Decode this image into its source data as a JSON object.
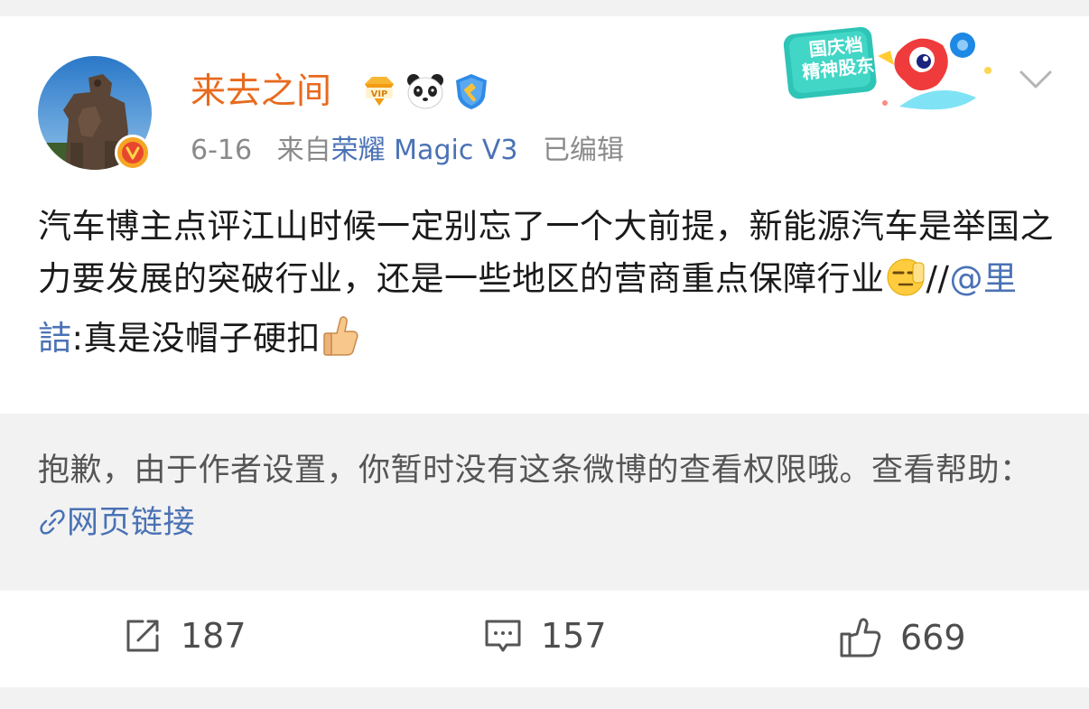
{
  "user": {
    "name": "来去之间",
    "verified_badge_icon": "orange-verified-v-icon",
    "badges": [
      "gold-vip-diamond-icon",
      "panda-icon",
      "blue-gavel-shield-icon"
    ]
  },
  "meta": {
    "date": "6-16",
    "from_prefix": "来自",
    "source": "荣耀 Magic V3",
    "edited": "已编辑"
  },
  "banner": {
    "line1": "国庆档",
    "line2": "精神股东"
  },
  "post": {
    "text_main": "汽车博主点评江山时候一定别忘了一个大前提，新能源汽车是举国之力要发展的突破行业，还是一些地区的营商重点保障行业",
    "emoji1": "smirk-emoji",
    "repost_sep": "//",
    "mention": "@里詰",
    "text_after": ":真是没帽子硬扣",
    "emoji2": "thumbs-up-emoji"
  },
  "notice": {
    "text": "抱歉，由于作者设置，你暂时没有这条微博的查看权限哦。查看帮助：",
    "link_icon": "link-icon",
    "link_label": "网页链接"
  },
  "actions": {
    "repost": {
      "icon": "repost-icon",
      "count": "187"
    },
    "comment": {
      "icon": "comment-icon",
      "count": "157"
    },
    "like": {
      "icon": "thumbs-up-outline-icon",
      "count": "669"
    }
  },
  "colors": {
    "username": "#e86a1e",
    "link": "#4a72b5",
    "text": "#1a1a1a",
    "notice_bg": "#f2f2f2"
  }
}
